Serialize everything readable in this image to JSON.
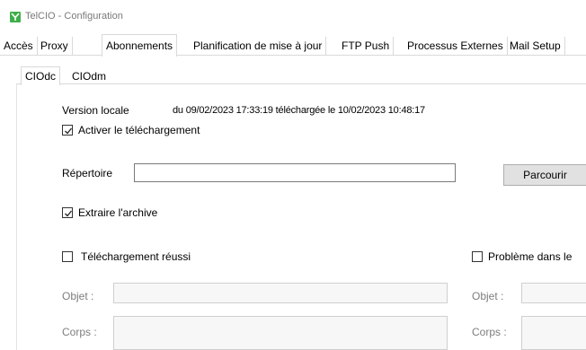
{
  "window": {
    "title": "TelCIO - Configuration",
    "icon": "telcio-app-icon",
    "accent": "#3fae49"
  },
  "tabs": [
    {
      "label": "Accès"
    },
    {
      "label": "Proxy"
    },
    {
      "label": "Abonnements",
      "active": true
    },
    {
      "label": "Planification de mise à jour"
    },
    {
      "label": "FTP Push"
    },
    {
      "label": "Processus Externes"
    },
    {
      "label": "Mail Setup"
    }
  ],
  "subtabs": [
    {
      "label": "CIOdc",
      "active": true
    },
    {
      "label": "CIOdm"
    }
  ],
  "version": {
    "label": "Version locale",
    "value": "du 09/02/2023 17:33:19 téléchargée le 10/02/2023 10:48:17"
  },
  "enable_download": {
    "label": "Activer le téléchargement",
    "checked": true
  },
  "directory": {
    "label": "Répertoire",
    "value": "",
    "browse_label": "Parcourir"
  },
  "extract_archive": {
    "label": "Extraire l'archive",
    "checked": true
  },
  "success": {
    "label": "Téléchargement réussi",
    "checked": false,
    "subject_label": "Objet :",
    "body_label": "Corps :"
  },
  "problem": {
    "label": "Problème dans le",
    "checked": false,
    "subject_label": "Objet :",
    "body_label": "Corps :"
  }
}
